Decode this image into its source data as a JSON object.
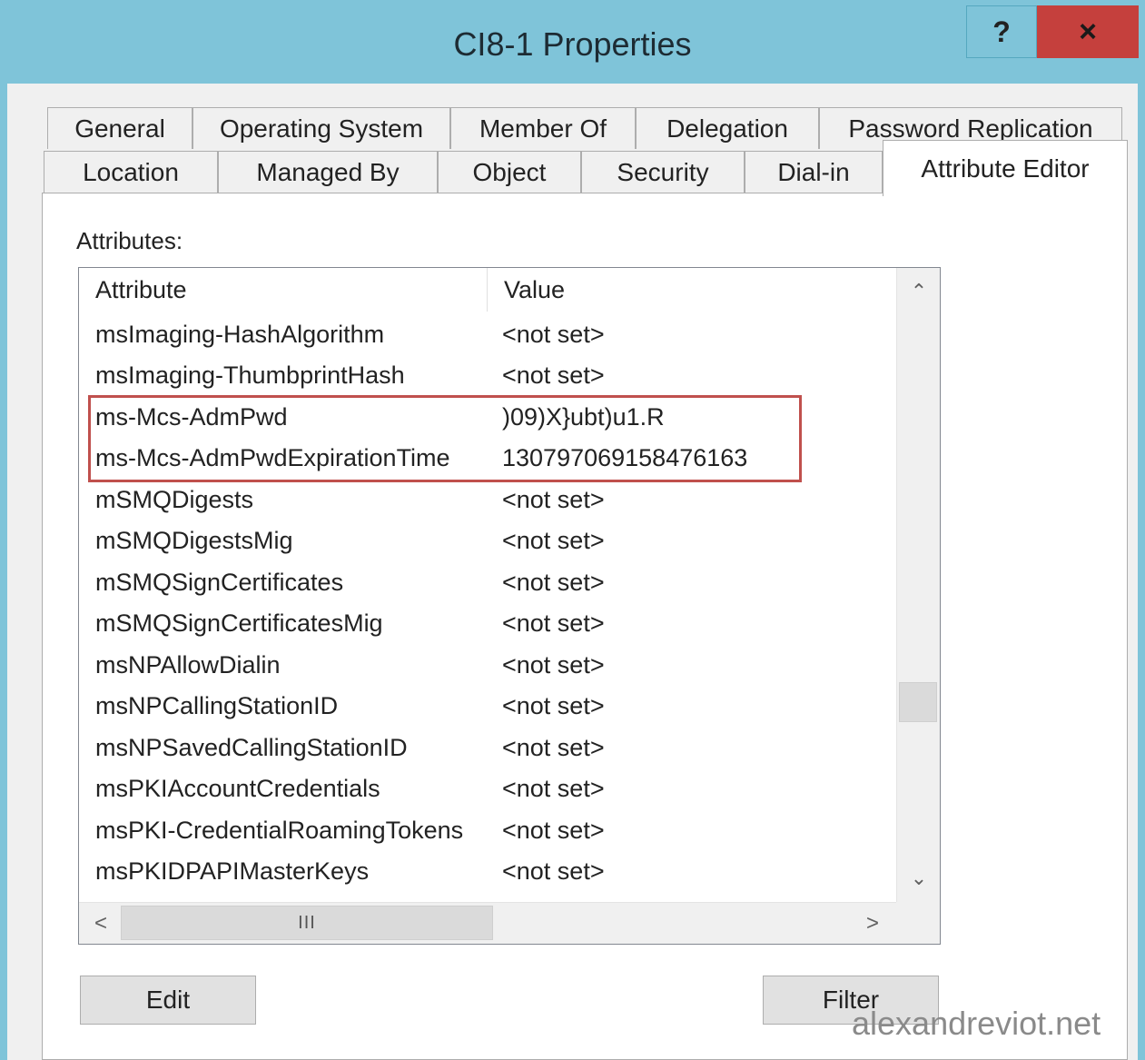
{
  "window": {
    "title": "CI8-1 Properties",
    "help_label": "?",
    "close_label": "×"
  },
  "tabs": {
    "row1": [
      "General",
      "Operating System",
      "Member Of",
      "Delegation",
      "Password Replication"
    ],
    "row2": [
      "Location",
      "Managed By",
      "Object",
      "Security",
      "Dial-in"
    ],
    "active": "Attribute Editor"
  },
  "attributes_label": "Attributes:",
  "table": {
    "columns": [
      "Attribute",
      "Value"
    ],
    "rows": [
      {
        "attribute": "msImaging-HashAlgorithm",
        "value": "<not set>"
      },
      {
        "attribute": "msImaging-ThumbprintHash",
        "value": "<not set>"
      },
      {
        "attribute": "ms-Mcs-AdmPwd",
        "value": ")09)X}ubt)u1.R"
      },
      {
        "attribute": "ms-Mcs-AdmPwdExpirationTime",
        "value": "130797069158476163"
      },
      {
        "attribute": "mSMQDigests",
        "value": "<not set>"
      },
      {
        "attribute": "mSMQDigestsMig",
        "value": "<not set>"
      },
      {
        "attribute": "mSMQSignCertificates",
        "value": "<not set>"
      },
      {
        "attribute": "mSMQSignCertificatesMig",
        "value": "<not set>"
      },
      {
        "attribute": "msNPAllowDialin",
        "value": "<not set>"
      },
      {
        "attribute": "msNPCallingStationID",
        "value": "<not set>"
      },
      {
        "attribute": "msNPSavedCallingStationID",
        "value": "<not set>"
      },
      {
        "attribute": "msPKIAccountCredentials",
        "value": "<not set>"
      },
      {
        "attribute": "msPKI-CredentialRoamingTokens",
        "value": "<not set>"
      },
      {
        "attribute": "msPKIDPAPIMasterKeys",
        "value": "<not set>"
      }
    ],
    "highlight_color": "#c0504d"
  },
  "scrollbar": {
    "up": "⌃",
    "down": "⌄",
    "left": "<",
    "right": ">",
    "thumb_grip": "III"
  },
  "buttons": {
    "edit": "Edit",
    "filter": "Filter"
  },
  "watermark": "alexandreviot.net",
  "colors": {
    "titlebar": "#7fc4d9",
    "close": "#c5403d"
  }
}
